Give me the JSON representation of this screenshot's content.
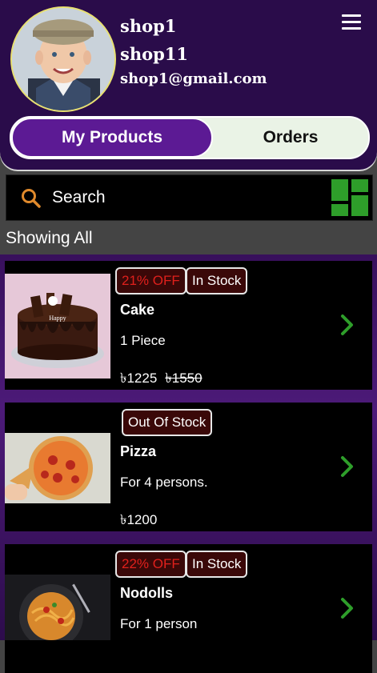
{
  "header": {
    "shop_name": "shop1",
    "shop_sub": "shop11",
    "email": "shop1@gmail.com",
    "menu_icon": "hamburger-menu-icon"
  },
  "tabs": {
    "active": "My Products",
    "inactive": "Orders"
  },
  "search": {
    "placeholder": "Search",
    "icon": "search-icon",
    "view_icon": "grid-view-icon"
  },
  "filter_label": "Showing All",
  "products": [
    {
      "discount": "21% OFF",
      "stock": "In Stock",
      "name": "Cake",
      "desc": "1 Piece",
      "price": "৳1225",
      "old_price": "৳1550"
    },
    {
      "discount": "",
      "stock": "Out Of Stock",
      "name": "Pizza",
      "desc": "For 4 persons.",
      "price": "৳1200",
      "old_price": ""
    },
    {
      "discount": "22% OFF",
      "stock": "In Stock",
      "name": "Nodolls",
      "desc": "For 1 person",
      "price": "",
      "old_price": ""
    }
  ],
  "colors": {
    "header_bg": "#2a0c4a",
    "accent_purple": "#5c1a94",
    "discount_red": "#e0201c",
    "chevron_green": "#2e9e2a",
    "grid_green": "#2e9e2a",
    "search_icon_orange": "#e08a2c"
  }
}
